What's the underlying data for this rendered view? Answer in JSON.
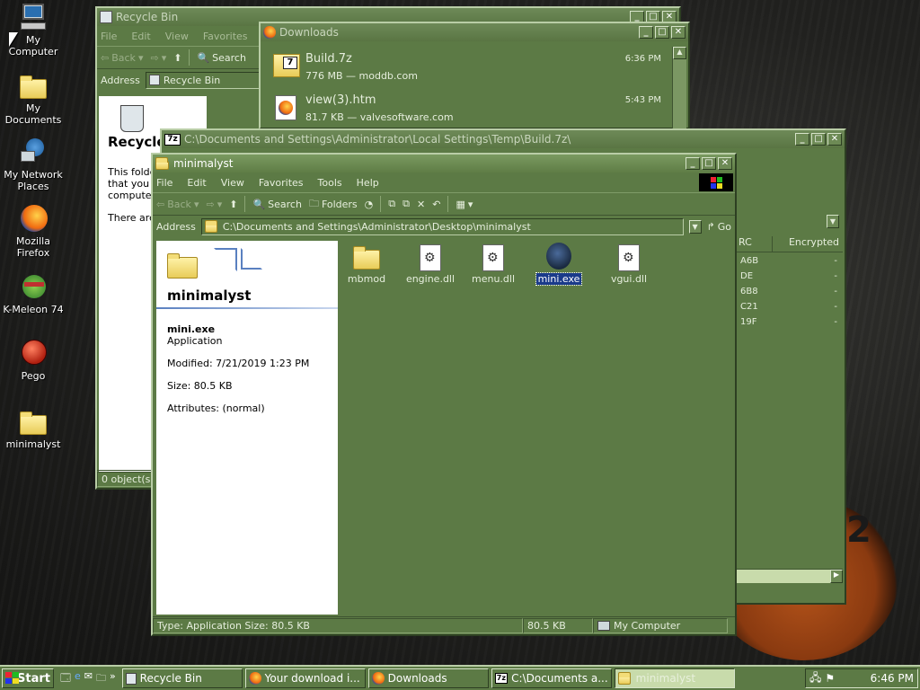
{
  "desktop": {
    "icons": [
      {
        "label": "My Computer"
      },
      {
        "label": "My Documents"
      },
      {
        "label": "My Network Places"
      },
      {
        "label": "Mozilla Firefox"
      },
      {
        "label": "K-Meleon 74"
      },
      {
        "label": "Pego"
      },
      {
        "label": "minimalyst"
      }
    ],
    "logo_text": "2"
  },
  "recycle_bin": {
    "title": "Recycle Bin",
    "menu": [
      "File",
      "Edit",
      "View",
      "Favorites"
    ],
    "back_label": "Back",
    "search_label": "Search",
    "address_label": "Address",
    "address_value": "Recycle Bin",
    "panel_title": "Recycle",
    "panel_text_1": "This folde",
    "panel_text_2": "that you l",
    "panel_text_3": "computer",
    "panel_text_4": "There are",
    "status": "0 object(s)"
  },
  "downloads": {
    "title": "Downloads",
    "items": [
      {
        "name": "Build.7z",
        "detail": "776 MB — moddb.com",
        "time": "6:36 PM"
      },
      {
        "name": "view(3).htm",
        "detail": "81.7 KB — valvesoftware.com",
        "time": "5:43 PM"
      }
    ]
  },
  "sevenzip": {
    "title": "C:\\Documents and Settings\\Administrator\\Local Settings\\Temp\\Build.7z\\",
    "columns": [
      "RC",
      "Encrypted"
    ],
    "rows": [
      {
        "crc": "A6B",
        "enc": "-"
      },
      {
        "crc": "DE",
        "enc": "-"
      },
      {
        "crc": "6B8",
        "enc": "-"
      },
      {
        "crc": "C21",
        "enc": "-"
      },
      {
        "crc": "19F",
        "enc": "-"
      }
    ]
  },
  "explorer": {
    "title": "minimalyst",
    "menu": [
      "File",
      "Edit",
      "View",
      "Favorites",
      "Tools",
      "Help"
    ],
    "toolbar": {
      "back": "Back",
      "search": "Search",
      "folders": "Folders"
    },
    "address_label": "Address",
    "address_value": "C:\\Documents and Settings\\Administrator\\Desktop\\minimalyst",
    "go_label": "Go",
    "panel": {
      "folder_title": "minimalyst",
      "file_name": "mini.exe",
      "file_type": "Application",
      "modified": "Modified: 7/21/2019 1:23 PM",
      "size": "Size: 80.5 KB",
      "attributes": "Attributes: (normal)"
    },
    "files": [
      {
        "name": "mbmod",
        "kind": "folder"
      },
      {
        "name": "engine.dll",
        "kind": "dll"
      },
      {
        "name": "menu.dll",
        "kind": "dll"
      },
      {
        "name": "mini.exe",
        "kind": "exe"
      },
      {
        "name": "vgui.dll",
        "kind": "dll"
      }
    ],
    "status": {
      "type": "Type: Application Size: 80.5 KB",
      "size": "80.5 KB",
      "zone": "My Computer"
    }
  },
  "taskbar": {
    "start": "Start",
    "tasks": [
      {
        "label": "Recycle Bin"
      },
      {
        "label": "Your download i..."
      },
      {
        "label": "Downloads"
      },
      {
        "label": "C:\\Documents a..."
      },
      {
        "label": "minimalyst"
      }
    ],
    "clock": "6:46 PM"
  }
}
